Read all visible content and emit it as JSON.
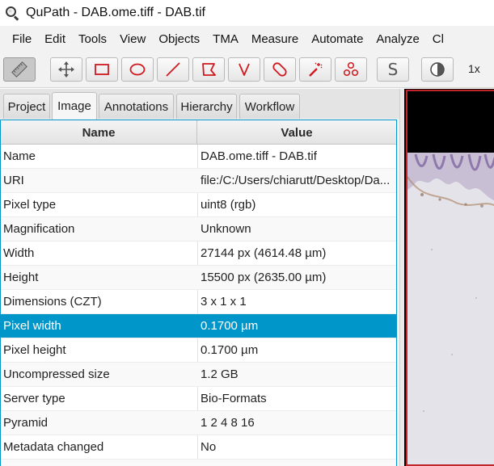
{
  "window": {
    "title": "QuPath - DAB.ome.tiff - DAB.tif"
  },
  "menu": [
    "File",
    "Edit",
    "Tools",
    "View",
    "Objects",
    "TMA",
    "Measure",
    "Automate",
    "Analyze",
    "Cl"
  ],
  "toolbar": {
    "tools": [
      "ruler-icon",
      "move-icon",
      "rectangle-icon",
      "ellipse-icon",
      "line-icon",
      "polygon-icon",
      "polyline-icon",
      "brush-icon",
      "wand-icon",
      "points-icon"
    ],
    "selection_mode_label": "S",
    "zoom": "1x"
  },
  "tabs": [
    "Project",
    "Image",
    "Annotations",
    "Hierarchy",
    "Workflow"
  ],
  "selected_tab": "Image",
  "table": {
    "headers": {
      "name": "Name",
      "value": "Value"
    },
    "rows": [
      {
        "key": "Name",
        "value": "DAB.ome.tiff - DAB.tif"
      },
      {
        "key": "URI",
        "value": "file:/C:/Users/chiarutt/Desktop/Da..."
      },
      {
        "key": "Pixel type",
        "value": "uint8 (rgb)"
      },
      {
        "key": "Magnification",
        "value": "Unknown"
      },
      {
        "key": "Width",
        "value": "27144 px (4614.48 µm)"
      },
      {
        "key": "Height",
        "value": "15500 px (2635.00 µm)"
      },
      {
        "key": "Dimensions (CZT)",
        "value": "3 x 1 x 1"
      },
      {
        "key": "Pixel width",
        "value": "0.1700 µm"
      },
      {
        "key": "Pixel height",
        "value": "0.1700 µm"
      },
      {
        "key": "Uncompressed size",
        "value": "1.2 GB"
      },
      {
        "key": "Server type",
        "value": "Bio-Formats"
      },
      {
        "key": "Pyramid",
        "value": "1 2 4 8 16"
      },
      {
        "key": "Metadata changed",
        "value": "No"
      },
      {
        "key": "",
        "value": ""
      }
    ],
    "selected_row": "Pixel width"
  },
  "colors": {
    "accent": "#0096c9",
    "tool_red": "#d0191f",
    "viewer_border": "#c0262b"
  }
}
